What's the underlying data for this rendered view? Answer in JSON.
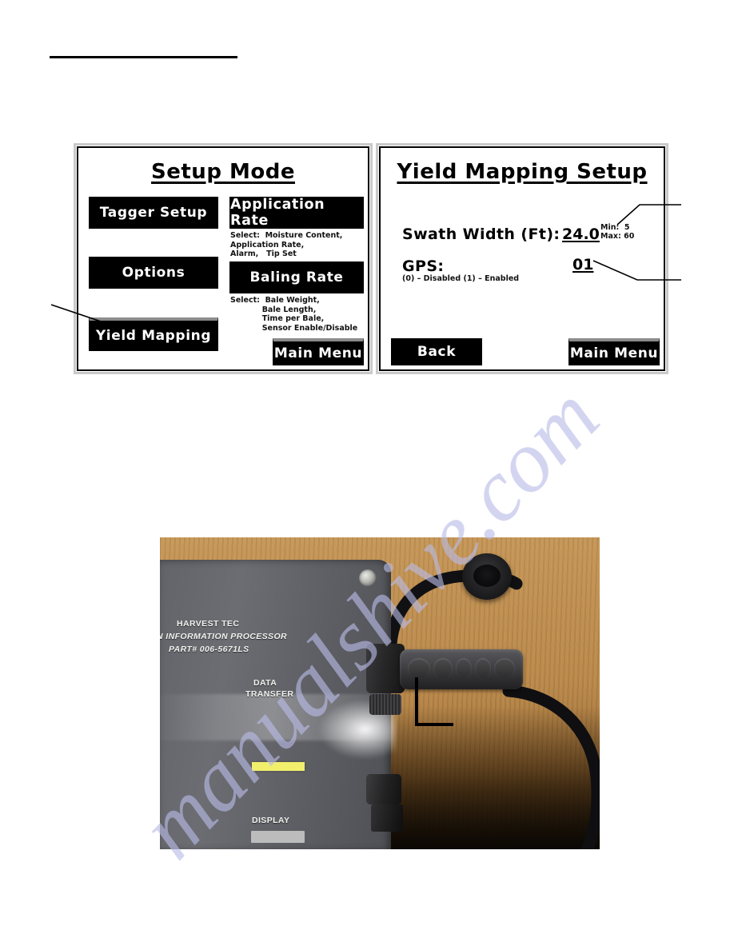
{
  "page": {
    "watermark": "manualshive.com"
  },
  "setup_mode_screen": {
    "title": "Setup Mode",
    "buttons": {
      "tagger_setup": "Tagger Setup",
      "options": "Options",
      "yield_mapping": "Yield Mapping",
      "application_rate": "Application Rate",
      "baling_rate": "Baling Rate",
      "main_menu": "Main Menu"
    },
    "application_rate_note": "Select:  Moisture Content,\nApplication Rate,\nAlarm,   Tip Set",
    "baling_rate_note": "Select:  Bale Weight,\n            Bale Length,\n            Time per Bale,\n            Sensor Enable/Disable"
  },
  "yield_mapping_screen": {
    "title": "Yield Mapping Setup",
    "swath_width_label": "Swath Width (Ft):",
    "swath_width_value": "24.0",
    "swath_min": "Min:  5",
    "swath_max": "Max: 60",
    "gps_label": "GPS:",
    "gps_value": "01",
    "gps_legend": "(0) – Disabled    (1) – Enabled",
    "buttons": {
      "back": "Back",
      "main_menu": "Main Menu"
    }
  },
  "photo": {
    "device_labels": {
      "brand": "HARVEST TEC",
      "model": "N INFORMATION PROCESSOR",
      "part": "PART# 006-5671LS",
      "data_transfer_line1": "DATA",
      "data_transfer_line2": "TRANSFER",
      "display": "DISPLAY"
    }
  }
}
